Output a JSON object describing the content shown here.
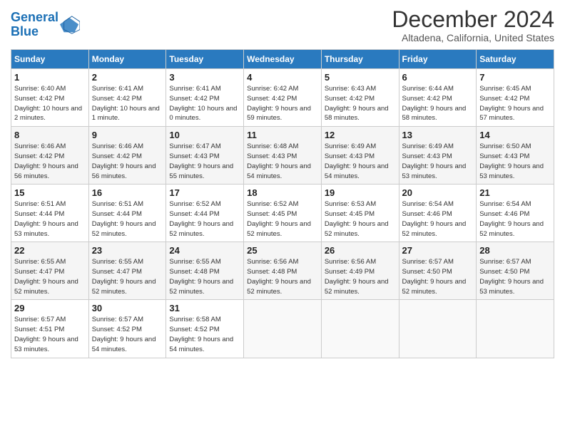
{
  "logo": {
    "line1": "General",
    "line2": "Blue"
  },
  "title": "December 2024",
  "subtitle": "Altadena, California, United States",
  "days_header": [
    "Sunday",
    "Monday",
    "Tuesday",
    "Wednesday",
    "Thursday",
    "Friday",
    "Saturday"
  ],
  "weeks": [
    [
      {
        "num": "1",
        "sunrise": "Sunrise: 6:40 AM",
        "sunset": "Sunset: 4:42 PM",
        "daylight": "Daylight: 10 hours and 2 minutes."
      },
      {
        "num": "2",
        "sunrise": "Sunrise: 6:41 AM",
        "sunset": "Sunset: 4:42 PM",
        "daylight": "Daylight: 10 hours and 1 minute."
      },
      {
        "num": "3",
        "sunrise": "Sunrise: 6:41 AM",
        "sunset": "Sunset: 4:42 PM",
        "daylight": "Daylight: 10 hours and 0 minutes."
      },
      {
        "num": "4",
        "sunrise": "Sunrise: 6:42 AM",
        "sunset": "Sunset: 4:42 PM",
        "daylight": "Daylight: 9 hours and 59 minutes."
      },
      {
        "num": "5",
        "sunrise": "Sunrise: 6:43 AM",
        "sunset": "Sunset: 4:42 PM",
        "daylight": "Daylight: 9 hours and 58 minutes."
      },
      {
        "num": "6",
        "sunrise": "Sunrise: 6:44 AM",
        "sunset": "Sunset: 4:42 PM",
        "daylight": "Daylight: 9 hours and 58 minutes."
      },
      {
        "num": "7",
        "sunrise": "Sunrise: 6:45 AM",
        "sunset": "Sunset: 4:42 PM",
        "daylight": "Daylight: 9 hours and 57 minutes."
      }
    ],
    [
      {
        "num": "8",
        "sunrise": "Sunrise: 6:46 AM",
        "sunset": "Sunset: 4:42 PM",
        "daylight": "Daylight: 9 hours and 56 minutes."
      },
      {
        "num": "9",
        "sunrise": "Sunrise: 6:46 AM",
        "sunset": "Sunset: 4:42 PM",
        "daylight": "Daylight: 9 hours and 56 minutes."
      },
      {
        "num": "10",
        "sunrise": "Sunrise: 6:47 AM",
        "sunset": "Sunset: 4:43 PM",
        "daylight": "Daylight: 9 hours and 55 minutes."
      },
      {
        "num": "11",
        "sunrise": "Sunrise: 6:48 AM",
        "sunset": "Sunset: 4:43 PM",
        "daylight": "Daylight: 9 hours and 54 minutes."
      },
      {
        "num": "12",
        "sunrise": "Sunrise: 6:49 AM",
        "sunset": "Sunset: 4:43 PM",
        "daylight": "Daylight: 9 hours and 54 minutes."
      },
      {
        "num": "13",
        "sunrise": "Sunrise: 6:49 AM",
        "sunset": "Sunset: 4:43 PM",
        "daylight": "Daylight: 9 hours and 53 minutes."
      },
      {
        "num": "14",
        "sunrise": "Sunrise: 6:50 AM",
        "sunset": "Sunset: 4:43 PM",
        "daylight": "Daylight: 9 hours and 53 minutes."
      }
    ],
    [
      {
        "num": "15",
        "sunrise": "Sunrise: 6:51 AM",
        "sunset": "Sunset: 4:44 PM",
        "daylight": "Daylight: 9 hours and 53 minutes."
      },
      {
        "num": "16",
        "sunrise": "Sunrise: 6:51 AM",
        "sunset": "Sunset: 4:44 PM",
        "daylight": "Daylight: 9 hours and 52 minutes."
      },
      {
        "num": "17",
        "sunrise": "Sunrise: 6:52 AM",
        "sunset": "Sunset: 4:44 PM",
        "daylight": "Daylight: 9 hours and 52 minutes."
      },
      {
        "num": "18",
        "sunrise": "Sunrise: 6:52 AM",
        "sunset": "Sunset: 4:45 PM",
        "daylight": "Daylight: 9 hours and 52 minutes."
      },
      {
        "num": "19",
        "sunrise": "Sunrise: 6:53 AM",
        "sunset": "Sunset: 4:45 PM",
        "daylight": "Daylight: 9 hours and 52 minutes."
      },
      {
        "num": "20",
        "sunrise": "Sunrise: 6:54 AM",
        "sunset": "Sunset: 4:46 PM",
        "daylight": "Daylight: 9 hours and 52 minutes."
      },
      {
        "num": "21",
        "sunrise": "Sunrise: 6:54 AM",
        "sunset": "Sunset: 4:46 PM",
        "daylight": "Daylight: 9 hours and 52 minutes."
      }
    ],
    [
      {
        "num": "22",
        "sunrise": "Sunrise: 6:55 AM",
        "sunset": "Sunset: 4:47 PM",
        "daylight": "Daylight: 9 hours and 52 minutes."
      },
      {
        "num": "23",
        "sunrise": "Sunrise: 6:55 AM",
        "sunset": "Sunset: 4:47 PM",
        "daylight": "Daylight: 9 hours and 52 minutes."
      },
      {
        "num": "24",
        "sunrise": "Sunrise: 6:55 AM",
        "sunset": "Sunset: 4:48 PM",
        "daylight": "Daylight: 9 hours and 52 minutes."
      },
      {
        "num": "25",
        "sunrise": "Sunrise: 6:56 AM",
        "sunset": "Sunset: 4:48 PM",
        "daylight": "Daylight: 9 hours and 52 minutes."
      },
      {
        "num": "26",
        "sunrise": "Sunrise: 6:56 AM",
        "sunset": "Sunset: 4:49 PM",
        "daylight": "Daylight: 9 hours and 52 minutes."
      },
      {
        "num": "27",
        "sunrise": "Sunrise: 6:57 AM",
        "sunset": "Sunset: 4:50 PM",
        "daylight": "Daylight: 9 hours and 52 minutes."
      },
      {
        "num": "28",
        "sunrise": "Sunrise: 6:57 AM",
        "sunset": "Sunset: 4:50 PM",
        "daylight": "Daylight: 9 hours and 53 minutes."
      }
    ],
    [
      {
        "num": "29",
        "sunrise": "Sunrise: 6:57 AM",
        "sunset": "Sunset: 4:51 PM",
        "daylight": "Daylight: 9 hours and 53 minutes."
      },
      {
        "num": "30",
        "sunrise": "Sunrise: 6:57 AM",
        "sunset": "Sunset: 4:52 PM",
        "daylight": "Daylight: 9 hours and 54 minutes."
      },
      {
        "num": "31",
        "sunrise": "Sunrise: 6:58 AM",
        "sunset": "Sunset: 4:52 PM",
        "daylight": "Daylight: 9 hours and 54 minutes."
      },
      null,
      null,
      null,
      null
    ]
  ]
}
